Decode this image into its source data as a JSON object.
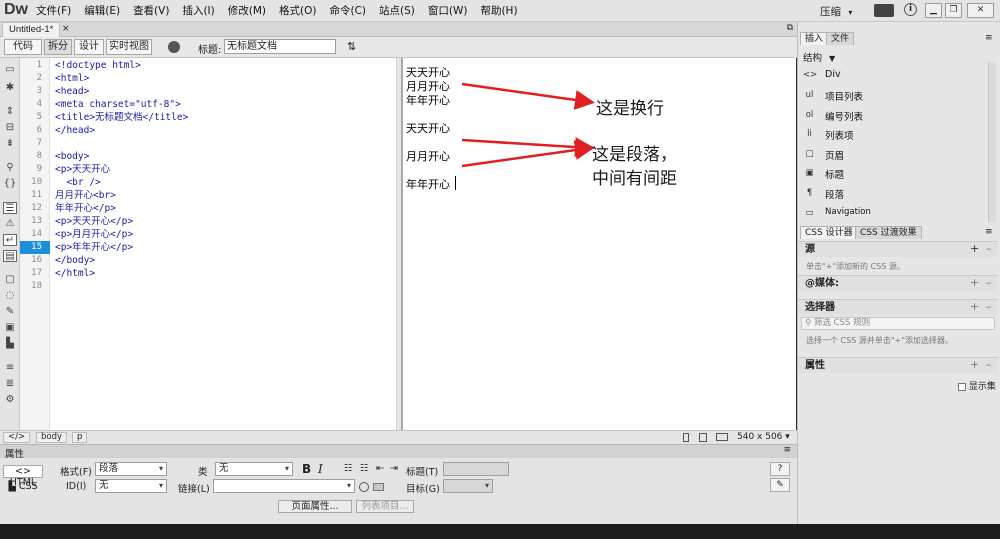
{
  "app": {
    "logo": "Dw",
    "menus": [
      "文件(F)",
      "编辑(E)",
      "查看(V)",
      "插入(I)",
      "修改(M)",
      "格式(O)",
      "命令(C)",
      "站点(S)",
      "窗口(W)",
      "帮助(H)"
    ],
    "compress_label": "压缩",
    "compress_arrow": "▾"
  },
  "document": {
    "tab_label": "Untitled-1*",
    "tab_close": "×"
  },
  "toolbar": {
    "code": "代码",
    "split": "拆分",
    "design": "设计",
    "live": "实时视图",
    "title_label": "标题:",
    "title_value": "无标题文档"
  },
  "code_lines": [
    {
      "n": "1",
      "text": "<!doctype html>"
    },
    {
      "n": "2",
      "text": "<html>"
    },
    {
      "n": "3",
      "text": "<head>"
    },
    {
      "n": "4",
      "text": "<meta charset=\"utf-8\">"
    },
    {
      "n": "5",
      "text": "<title>无标题文档</title>"
    },
    {
      "n": "6",
      "text": "</head>"
    },
    {
      "n": "7",
      "text": ""
    },
    {
      "n": "8",
      "text": "<body>"
    },
    {
      "n": "9",
      "text": "<p>天天开心"
    },
    {
      "n": "10",
      "text": "  <br />"
    },
    {
      "n": "11",
      "text": "月月开心<br>"
    },
    {
      "n": "12",
      "text": "年年开心</p>"
    },
    {
      "n": "13",
      "text": "<p>天天开心</p>"
    },
    {
      "n": "14",
      "text": "<p>月月开心</p>"
    },
    {
      "n": "15",
      "text": "<p>年年开心</p>"
    },
    {
      "n": "16",
      "text": "</body>"
    },
    {
      "n": "17",
      "text": "</html>"
    },
    {
      "n": "18",
      "text": ""
    }
  ],
  "live_view": {
    "para1": [
      "天天开心",
      "月月开心",
      "年年开心"
    ],
    "para2": "天天开心",
    "para3": "月月开心",
    "para4": "年年开心",
    "note_br": "这是换行",
    "note_p_line1": "这是段落，",
    "note_p_line2": "中间有间距"
  },
  "status": {
    "tag1": "body",
    "tag2": "p",
    "size": "540 x 506",
    "size_arrow": "▾"
  },
  "properties": {
    "header": "属性",
    "html_btn": "HTML",
    "css_btn": "CSS",
    "format_label": "格式(F)",
    "format_value": "段落",
    "id_label": "ID(I)",
    "id_value": "无",
    "class_label": "类",
    "class_value": "无",
    "link_label": "链接(L)",
    "title_label": "标题(T)",
    "target_label": "目标(G)",
    "bold": "B",
    "italic": "I",
    "page_props_btn": "页面属性...",
    "list_item_btn": "列表项目..."
  },
  "insert_panel": {
    "tab_insert": "插入",
    "tab_files": "文件",
    "category": "结构",
    "items": [
      {
        "icon": "<>",
        "label": "Div"
      },
      {
        "icon": "ul",
        "label": "项目列表"
      },
      {
        "icon": "ol",
        "label": "编号列表"
      },
      {
        "icon": "li",
        "label": "列表项"
      },
      {
        "icon": "□",
        "label": "页眉"
      },
      {
        "icon": "▣",
        "label": "标题"
      },
      {
        "icon": "¶",
        "label": "段落"
      },
      {
        "icon": "▭",
        "label": "Navigation"
      }
    ]
  },
  "css_panel": {
    "tab_designer": "CSS 设计器",
    "tab_transitions": "CSS 过渡效果",
    "source_head": "源",
    "source_hint": "单击\"+\"添加新的 CSS 源。",
    "media_head": "@媒体:",
    "selector_head": "选择器",
    "selector_filter": "筛选 CSS 规则",
    "selector_hint": "选择一个 CSS 源并单击\"+\"添加选择器。",
    "props_head": "属性",
    "show_set": "显示集"
  }
}
